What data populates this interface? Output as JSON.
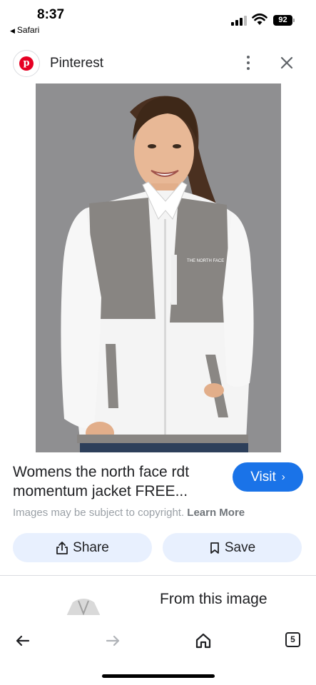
{
  "status_bar": {
    "time": "8:37",
    "back_app": "Safari",
    "battery": "92"
  },
  "header": {
    "site_name": "Pinterest",
    "logo_letter": "p",
    "logo_color": "#e60023"
  },
  "image": {
    "brand_text": "THE NORTH FACE"
  },
  "result": {
    "title": "Womens the north face rdt momentum jacket FREE...",
    "visit_label": "Visit",
    "visit_chevron": "›",
    "copyright_text": "Images may be subject to copyright.",
    "learn_more": "Learn More",
    "accent_color": "#1a73e8"
  },
  "actions": {
    "share_label": "Share",
    "save_label": "Save"
  },
  "related": {
    "heading": "From this image"
  },
  "bottom_nav": {
    "tab_count": "5",
    "icons": [
      "back-arrow-icon",
      "forward-arrow-icon",
      "home-icon",
      "tabs-icon"
    ]
  }
}
